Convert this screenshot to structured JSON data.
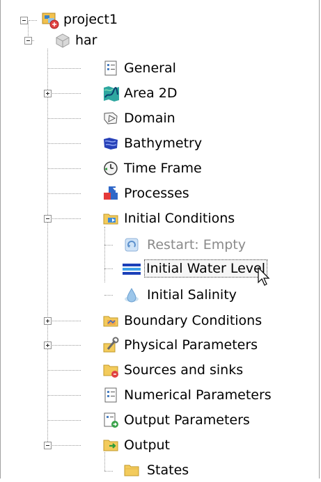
{
  "tree": {
    "root": {
      "label": "project1",
      "icon": "project-icon",
      "expanded": true
    },
    "model": {
      "label": "har",
      "icon": "model-cube-icon",
      "expanded": true
    },
    "items": [
      {
        "key": "general",
        "label": "General",
        "icon": "document-properties-icon"
      },
      {
        "key": "area2d",
        "label": "Area 2D",
        "icon": "area-map-icon",
        "expander": "plus"
      },
      {
        "key": "domain",
        "label": "Domain",
        "icon": "domain-outline-icon"
      },
      {
        "key": "bathymetry",
        "label": "Bathymetry",
        "icon": "bathymetry-icon"
      },
      {
        "key": "timeframe",
        "label": "Time Frame",
        "icon": "clock-icon"
      },
      {
        "key": "processes",
        "label": "Processes",
        "icon": "processes-blocks-icon"
      },
      {
        "key": "initial",
        "label": "Initial Conditions",
        "icon": "folder-initial-icon",
        "expander": "minus",
        "children": [
          {
            "key": "restart",
            "label": "Restart: Empty",
            "icon": "restart-icon",
            "muted": true
          },
          {
            "key": "waterlevel",
            "label": "Initial Water Level",
            "icon": "water-level-icon",
            "selected": true
          },
          {
            "key": "salinity",
            "label": "Initial Salinity",
            "icon": "salinity-drop-icon"
          }
        ]
      },
      {
        "key": "boundary",
        "label": "Boundary Conditions",
        "icon": "folder-boundary-icon",
        "expander": "plus"
      },
      {
        "key": "physical",
        "label": "Physical Parameters",
        "icon": "wrench-settings-icon",
        "expander": "plus"
      },
      {
        "key": "sources",
        "label": "Sources and sinks",
        "icon": "folder-sources-icon"
      },
      {
        "key": "numerical",
        "label": "Numerical Parameters",
        "icon": "numerical-document-icon"
      },
      {
        "key": "outputparams",
        "label": "Output Parameters",
        "icon": "output-document-icon"
      },
      {
        "key": "output",
        "label": "Output",
        "icon": "folder-output-icon",
        "expander": "minus",
        "children": [
          {
            "key": "states",
            "label": "States",
            "icon": "folder-icon"
          }
        ]
      }
    ]
  }
}
